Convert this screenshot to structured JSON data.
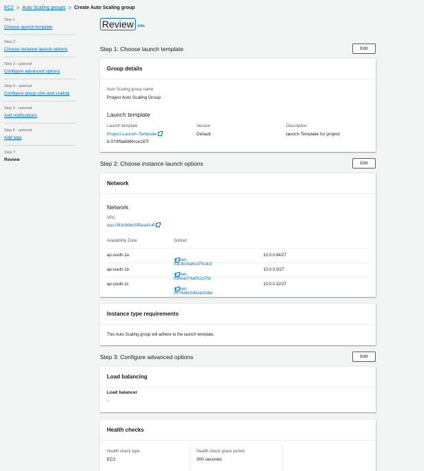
{
  "breadcrumb": {
    "root": "EC2",
    "parent": "Auto Scaling groups",
    "current": "Create Auto Scaling group"
  },
  "steps": [
    {
      "num": "Step 1",
      "optional": "",
      "name": "Choose launch template"
    },
    {
      "num": "Step 2",
      "optional": "",
      "name": "Choose instance launch options"
    },
    {
      "num": "Step 3",
      "optional": "optional",
      "name": "Configure advanced options"
    },
    {
      "num": "Step 4",
      "optional": "optional",
      "name": "Configure group size and scaling"
    },
    {
      "num": "Step 5",
      "optional": "optional",
      "name": "Add notifications"
    },
    {
      "num": "Step 6",
      "optional": "optional",
      "name": "Add tags"
    },
    {
      "num": "Step 7",
      "optional": "",
      "name": "Review"
    }
  ],
  "page": {
    "title": "Review",
    "info": "Info"
  },
  "edit_label": "Edit",
  "step1": {
    "heading": "Step 1: Choose launch template",
    "group_details": "Group details",
    "asg_name_label": "Auto Scaling group name",
    "asg_name": "Project Auto Scaling Group",
    "launch_template_heading": "Launch template",
    "lt_label": "Launch template",
    "lt_name": "Project-Launch-Template",
    "lt_id": "lt-070f9a696fcce187f",
    "version_label": "Version",
    "version": "Default",
    "desc_label": "Description",
    "desc": "launch Template for project"
  },
  "step2": {
    "heading": "Step 2: Choose instance launch options",
    "network_card": "Network",
    "network_heading": "Network",
    "vpc_label": "VPC",
    "vpc": "vpc-093cb9bc5f5ea414f",
    "az_label": "Availability Zone",
    "subnet_label": "Subnet",
    "zones": [
      {
        "az": "ap-south-1a",
        "subnet": "subnet-0ac3b2ba6cd75cdc3",
        "cidr": "10.0.0.64/27"
      },
      {
        "az": "ap-south-1b",
        "subnet": "subnet-0d4ea074a0fc2d7fd",
        "cidr": "10.0.0.0/27"
      },
      {
        "az": "ap-south-1c",
        "subnet": "subnet-0675d4e3d9dac0dbe",
        "cidr": "10.0.0.32/27"
      }
    ],
    "itr_card": "Instance type requirements",
    "itr_text": "This Auto Scaling group will adhere to the launch template."
  },
  "step3": {
    "heading": "Step 3: Configure advanced options",
    "lb_card": "Load balancing",
    "lb_label": "Load balancer",
    "lb_value": "-",
    "hc_card": "Health checks",
    "hc_type_label": "Health check type",
    "hc_type": "EC2",
    "hc_grace_label": "Health check grace period",
    "hc_grace": "300 seconds"
  }
}
